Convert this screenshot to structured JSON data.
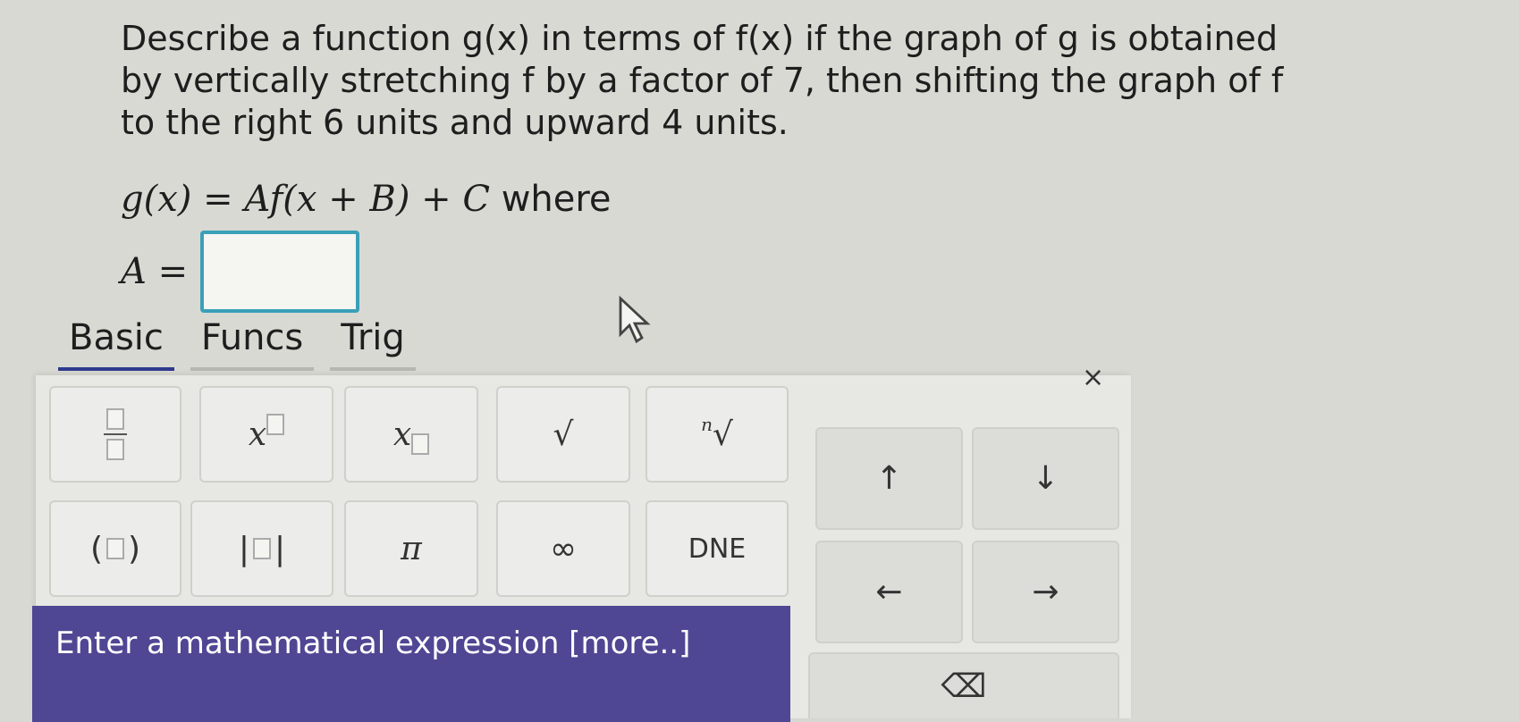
{
  "question": {
    "line1": "Describe a function g(x) in terms of f(x) if the graph of g is obtained",
    "line2": "by vertically stretching f by a factor of 7, then shifting the graph of f",
    "line3": "to the right 6 units and upward 4 units.",
    "formula": "g(x) = Af(x + B) + C",
    "formula_suffix": "where",
    "answer_label": "A ="
  },
  "tabs": [
    {
      "label": "Basic",
      "active": true
    },
    {
      "label": "Funcs",
      "active": false
    },
    {
      "label": "Trig",
      "active": false
    }
  ],
  "keypad": {
    "close": "×",
    "keys": {
      "superscript_base": "x",
      "subscript_base": "x",
      "sqrt": "√",
      "nthroot_index": "n",
      "nthroot": "√",
      "up": "↑",
      "down": "↓",
      "paren_open": "(",
      "paren_close": ")",
      "abs_open": "|",
      "abs_close": "|",
      "pi": "π",
      "infinity": "∞",
      "dne": "DNE",
      "left": "←",
      "right": "→",
      "backspace": "⌫"
    }
  },
  "info_bar": {
    "text": "Enter a mathematical expression [more..]"
  },
  "colors": {
    "accent": "#4f4793",
    "focus_border": "#3aa0b8",
    "active_tab": "#2e3a8c"
  }
}
